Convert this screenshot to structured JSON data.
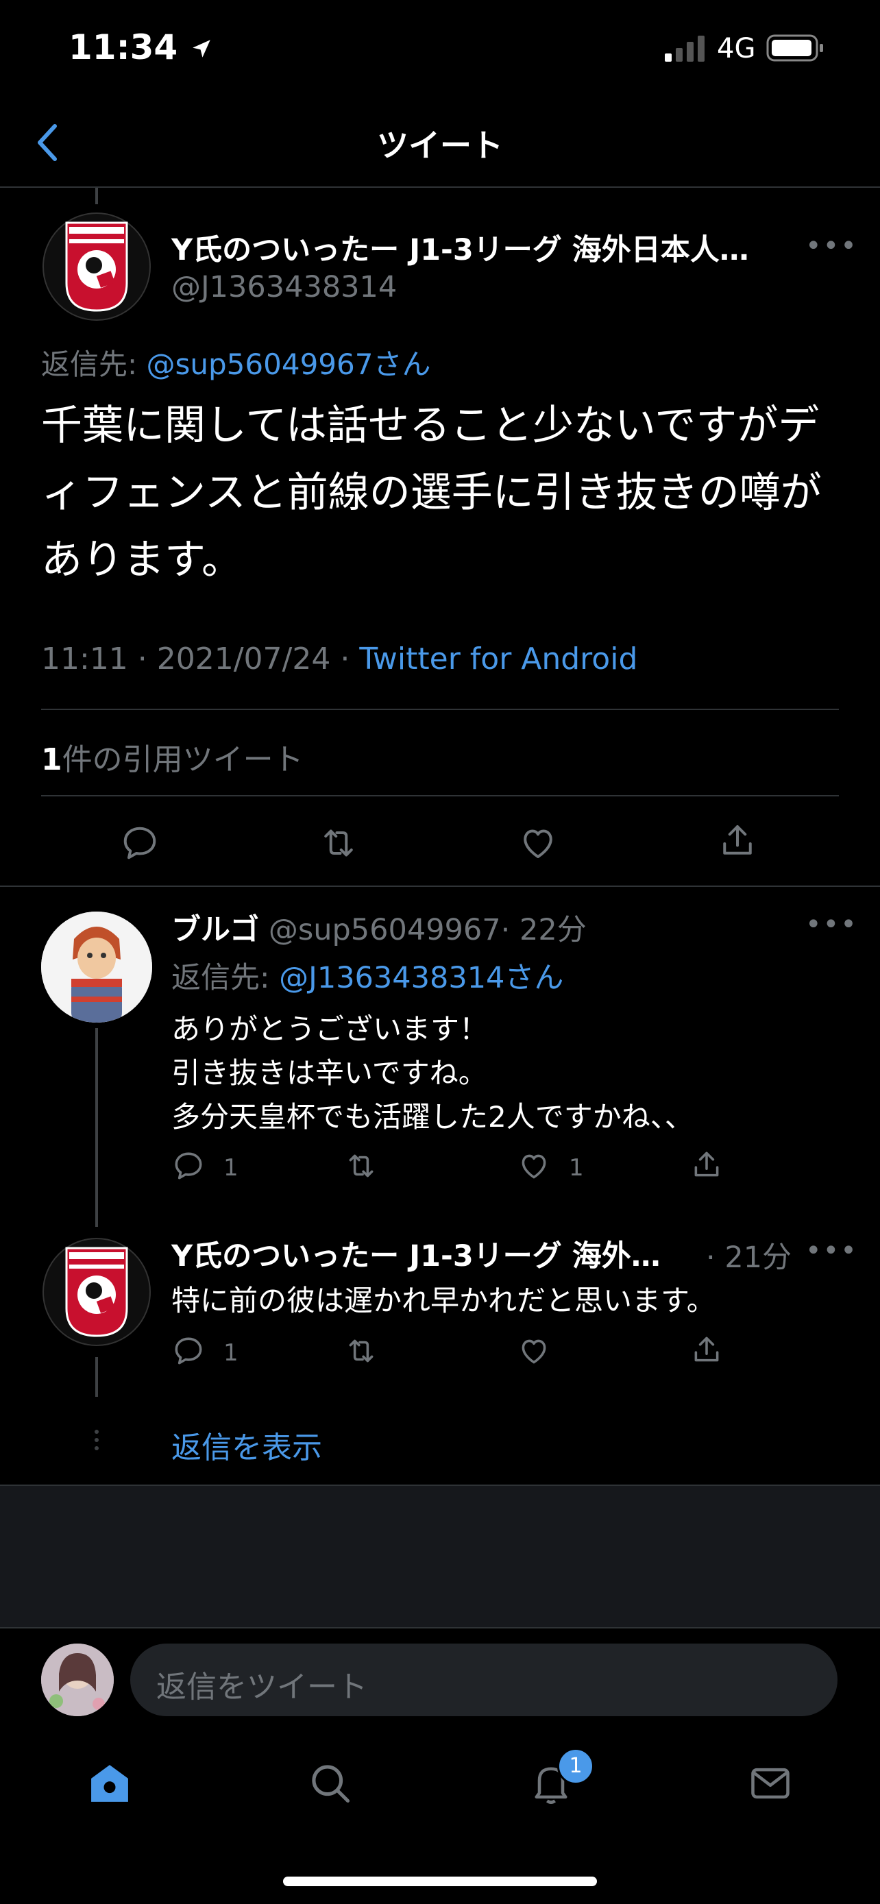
{
  "status_bar": {
    "time": "11:34",
    "network": "4G"
  },
  "header": {
    "title": "ツイート"
  },
  "main_tweet": {
    "display_name": "Y氏のついったー J1-3リーグ 海外日本人…",
    "handle": "@J1363438314",
    "reply_to_prefix": "返信先: ",
    "reply_to_handle": "@sup56049967さん",
    "text": "千葉に関しては話せること少ないですがディフェンスと前線の選手に引き抜きの噂があります。",
    "time_date": "11:11 · 2021/07/24 · ",
    "source": "Twitter for Android",
    "quote_count": "1",
    "quote_label": "件の引用ツイート"
  },
  "replies": [
    {
      "display_name": "ブルゴ",
      "handle": "@sup56049967",
      "time": "· 22分",
      "reply_to_prefix": "返信先: ",
      "reply_to_handle": "@J1363438314さん",
      "text_lines": [
        "ありがとうございます！",
        "引き抜きは辛いですね。",
        "多分天皇杯でも活躍した2人ですかね、、"
      ],
      "reply_count": "1",
      "like_count": "1"
    },
    {
      "display_name": "Y氏のついったー J1-3リーグ 海外…",
      "time": "· 21分",
      "text": "特に前の彼は遅かれ早かれだと思います。",
      "reply_count": "1"
    }
  ],
  "show_replies": "返信を表示",
  "composer": {
    "placeholder": "返信をツイート"
  },
  "tab_bar": {
    "notification_badge": "1"
  },
  "colors": {
    "accent": "#4a99e9",
    "background": "#000000",
    "muted": "#71767b"
  }
}
